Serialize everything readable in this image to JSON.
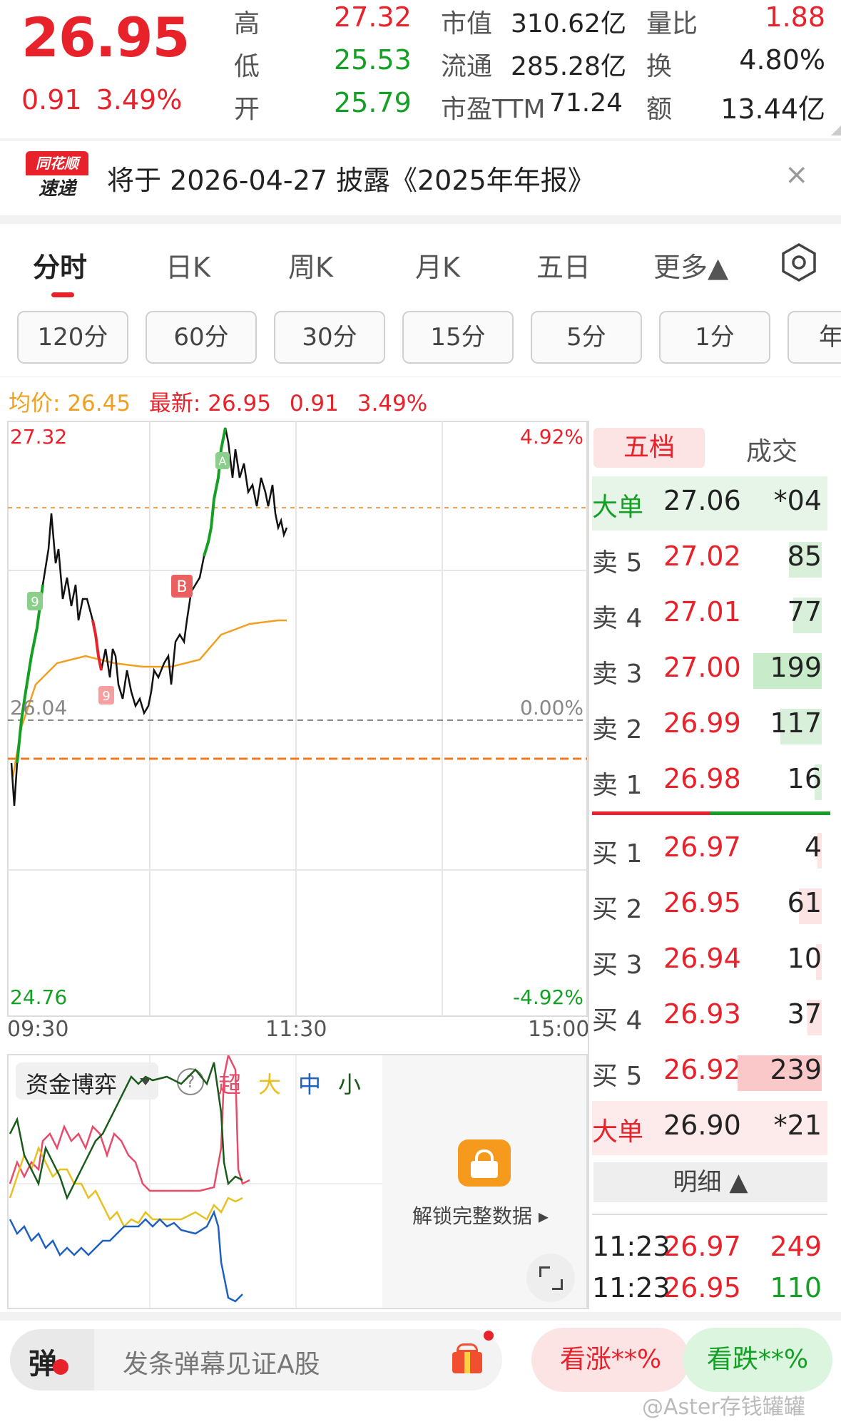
{
  "header": {
    "price": "26.95",
    "change": "0.91",
    "change_pct": "3.49%",
    "quotes": [
      {
        "label": "高",
        "value": "27.32",
        "color": "red"
      },
      {
        "label": "低",
        "value": "25.53",
        "color": "green"
      },
      {
        "label": "开",
        "value": "25.79",
        "color": "green"
      }
    ],
    "stats": [
      {
        "label": "市值",
        "value": "310.62亿"
      },
      {
        "label": "流通",
        "value": "285.28亿"
      },
      {
        "label": "市盈TTM",
        "value": "71.24"
      }
    ],
    "stats2": [
      {
        "label": "量比",
        "value": "1.88",
        "color": "red"
      },
      {
        "label": "换",
        "value": "4.80%",
        "color": "black"
      },
      {
        "label": "额",
        "value": "13.44亿",
        "color": "black"
      }
    ]
  },
  "notice": {
    "logo_top": "同花顺",
    "logo_bottom": "速递",
    "text": "将于 2026-04-27 披露《2025年年报》",
    "close": "×"
  },
  "tabs": [
    "分时",
    "日K",
    "周K",
    "月K",
    "五日",
    "更多▲"
  ],
  "intervals": [
    "120分",
    "60分",
    "30分",
    "15分",
    "5分",
    "1分",
    "年"
  ],
  "chart": {
    "avg_label": "均价:",
    "avg_value": "26.45",
    "latest_label": "最新:",
    "latest_value": "26.95",
    "latest_change": "0.91",
    "latest_pct": "3.49%",
    "price_high": "27.32",
    "price_mid": "26.04",
    "price_low": "24.76",
    "pct_high": "4.92%",
    "pct_mid": "0.00%",
    "pct_low": "-4.92%",
    "time_start": "09:30",
    "time_mid": "11:30",
    "time_end": "15:00",
    "markers": [
      "9",
      "9",
      "B",
      "A"
    ]
  },
  "chart_data": {
    "type": "line",
    "ylim": [
      24.76,
      27.32
    ],
    "prev_close": 26.04,
    "x_labels": [
      "09:30",
      "11:30",
      "15:00"
    ],
    "series": [
      {
        "name": "price",
        "points": [
          [
            0,
            25.6
          ],
          [
            5,
            26.3
          ],
          [
            10,
            26.55
          ],
          [
            15,
            26.9
          ],
          [
            20,
            27.05
          ],
          [
            25,
            26.8
          ],
          [
            30,
            26.9
          ],
          [
            35,
            26.6
          ],
          [
            40,
            26.3
          ],
          [
            45,
            26.45
          ],
          [
            50,
            26.1
          ],
          [
            55,
            26.05
          ],
          [
            60,
            26.15
          ],
          [
            65,
            26.4
          ],
          [
            70,
            26.6
          ],
          [
            75,
            26.9
          ],
          [
            80,
            27.3
          ],
          [
            82,
            27.05
          ],
          [
            85,
            27.1
          ],
          [
            88,
            26.95
          ],
          [
            90,
            26.98
          ]
        ]
      },
      {
        "name": "avg",
        "points": [
          [
            0,
            25.8
          ],
          [
            10,
            26.3
          ],
          [
            20,
            26.4
          ],
          [
            30,
            26.4
          ],
          [
            40,
            26.4
          ],
          [
            50,
            26.4
          ],
          [
            60,
            26.45
          ],
          [
            70,
            26.55
          ],
          [
            80,
            26.6
          ],
          [
            90,
            26.62
          ]
        ]
      }
    ]
  },
  "fund_panel": {
    "title": "资金博弈",
    "legend": [
      "超",
      "大",
      "中",
      "小"
    ],
    "unlock": "解锁完整数据"
  },
  "orderbook": {
    "tabs": [
      "五档",
      "成交"
    ],
    "big_sell": {
      "label": "大单",
      "price": "27.06",
      "vol": "*04"
    },
    "sells": [
      {
        "label": "卖 5",
        "price": "27.02",
        "vol": "85"
      },
      {
        "label": "卖 4",
        "price": "27.01",
        "vol": "77"
      },
      {
        "label": "卖 3",
        "price": "27.00",
        "vol": "199"
      },
      {
        "label": "卖 2",
        "price": "26.99",
        "vol": "117"
      },
      {
        "label": "卖 1",
        "price": "26.98",
        "vol": "16"
      }
    ],
    "buys": [
      {
        "label": "买 1",
        "price": "26.97",
        "vol": "4"
      },
      {
        "label": "买 2",
        "price": "26.95",
        "vol": "61"
      },
      {
        "label": "买 3",
        "price": "26.94",
        "vol": "10"
      },
      {
        "label": "买 4",
        "price": "26.93",
        "vol": "37"
      },
      {
        "label": "买 5",
        "price": "26.92",
        "vol": "239"
      }
    ],
    "big_buy": {
      "label": "大单",
      "price": "26.90",
      "vol": "*21"
    },
    "detail_label": "明细 ▲",
    "ticks": [
      {
        "time": "11:23",
        "price": "26.97",
        "vol": "249",
        "color": "red"
      },
      {
        "time": "11:23",
        "price": "26.95",
        "vol": "110",
        "color": "green"
      }
    ]
  },
  "bottom": {
    "danmu_icon": "弹",
    "danmu_placeholder": "发条弹幕见证A股",
    "up": "看涨**%",
    "down": "看跌**%",
    "watermark": "@Aster存钱罐罐"
  }
}
